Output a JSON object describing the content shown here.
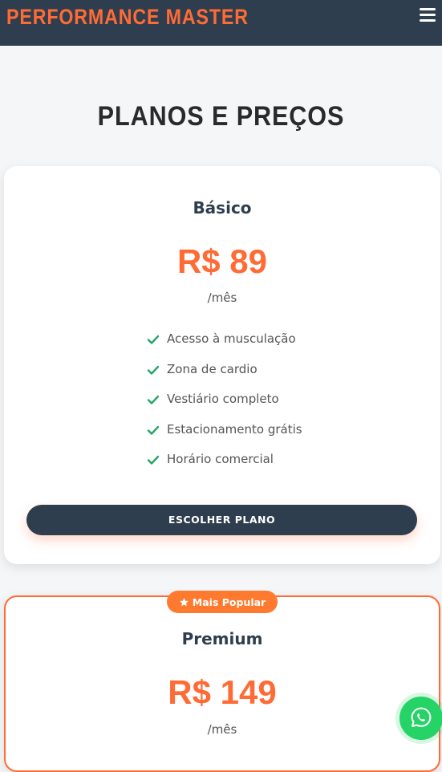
{
  "header": {
    "brand": "PERFORMANCE MASTER",
    "menu_icon": "hamburger-menu-icon"
  },
  "section": {
    "title": "PLANOS E PREÇOS"
  },
  "plans": [
    {
      "name": "Básico",
      "price": "R$ 89",
      "period": "/mês",
      "features": [
        "Acesso à musculação",
        "Zona de cardio",
        "Vestiário completo",
        "Estacionamento grátis",
        "Horário comercial"
      ],
      "button_label": "ESCOLHER PLANO"
    },
    {
      "badge": "Mais Popular",
      "name": "Premium",
      "price": "R$ 149",
      "period": "/mês"
    }
  ],
  "colors": {
    "accent": "#ff6b35",
    "header_bg": "#2f3e4e",
    "check": "#27a567",
    "whatsapp": "#25d366"
  },
  "floating": {
    "icon": "whatsapp-icon"
  }
}
